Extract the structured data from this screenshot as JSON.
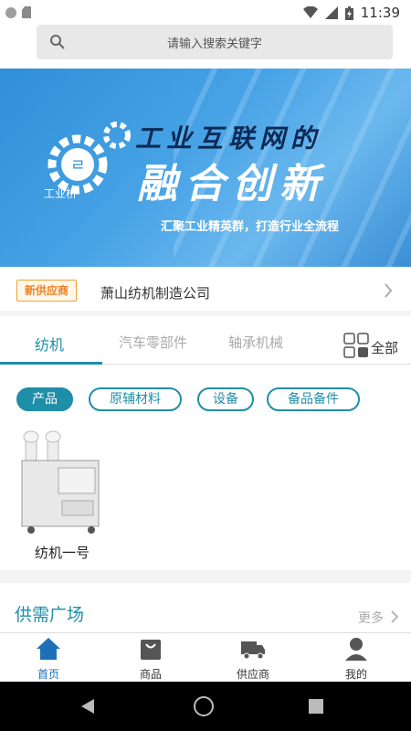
{
  "status_bar": {
    "time": "11:39"
  },
  "search": {
    "placeholder": "请输入搜索关键字"
  },
  "banner": {
    "logo_text": "工业桥",
    "title_line1": "工业互联网的",
    "title_line2": "融合创新",
    "subtitle": "汇聚工业精英群，打造行业全流程"
  },
  "supplier": {
    "badge": "新供应商",
    "name": "萧山纺机制造公司"
  },
  "tabs": {
    "items": [
      "纺机",
      "汽车零部件",
      "轴承机械"
    ],
    "all_label": "全部"
  },
  "chips": [
    "产品",
    "原辅材料",
    "设备",
    "备品备件"
  ],
  "products": [
    {
      "name": "纺机一号"
    }
  ],
  "supply_demand": {
    "title": "供需广场",
    "more": "更多"
  },
  "bottom_nav": [
    {
      "label": "首页",
      "icon": "home-icon",
      "active": true
    },
    {
      "label": "商品",
      "icon": "shopping-bag-icon",
      "active": false
    },
    {
      "label": "供应商",
      "icon": "truck-icon",
      "active": false
    },
    {
      "label": "我的",
      "icon": "person-icon",
      "active": false
    }
  ],
  "colors": {
    "accent": "#1f8ea8",
    "nav_active": "#1f6fb8",
    "badge": "#f08020"
  }
}
